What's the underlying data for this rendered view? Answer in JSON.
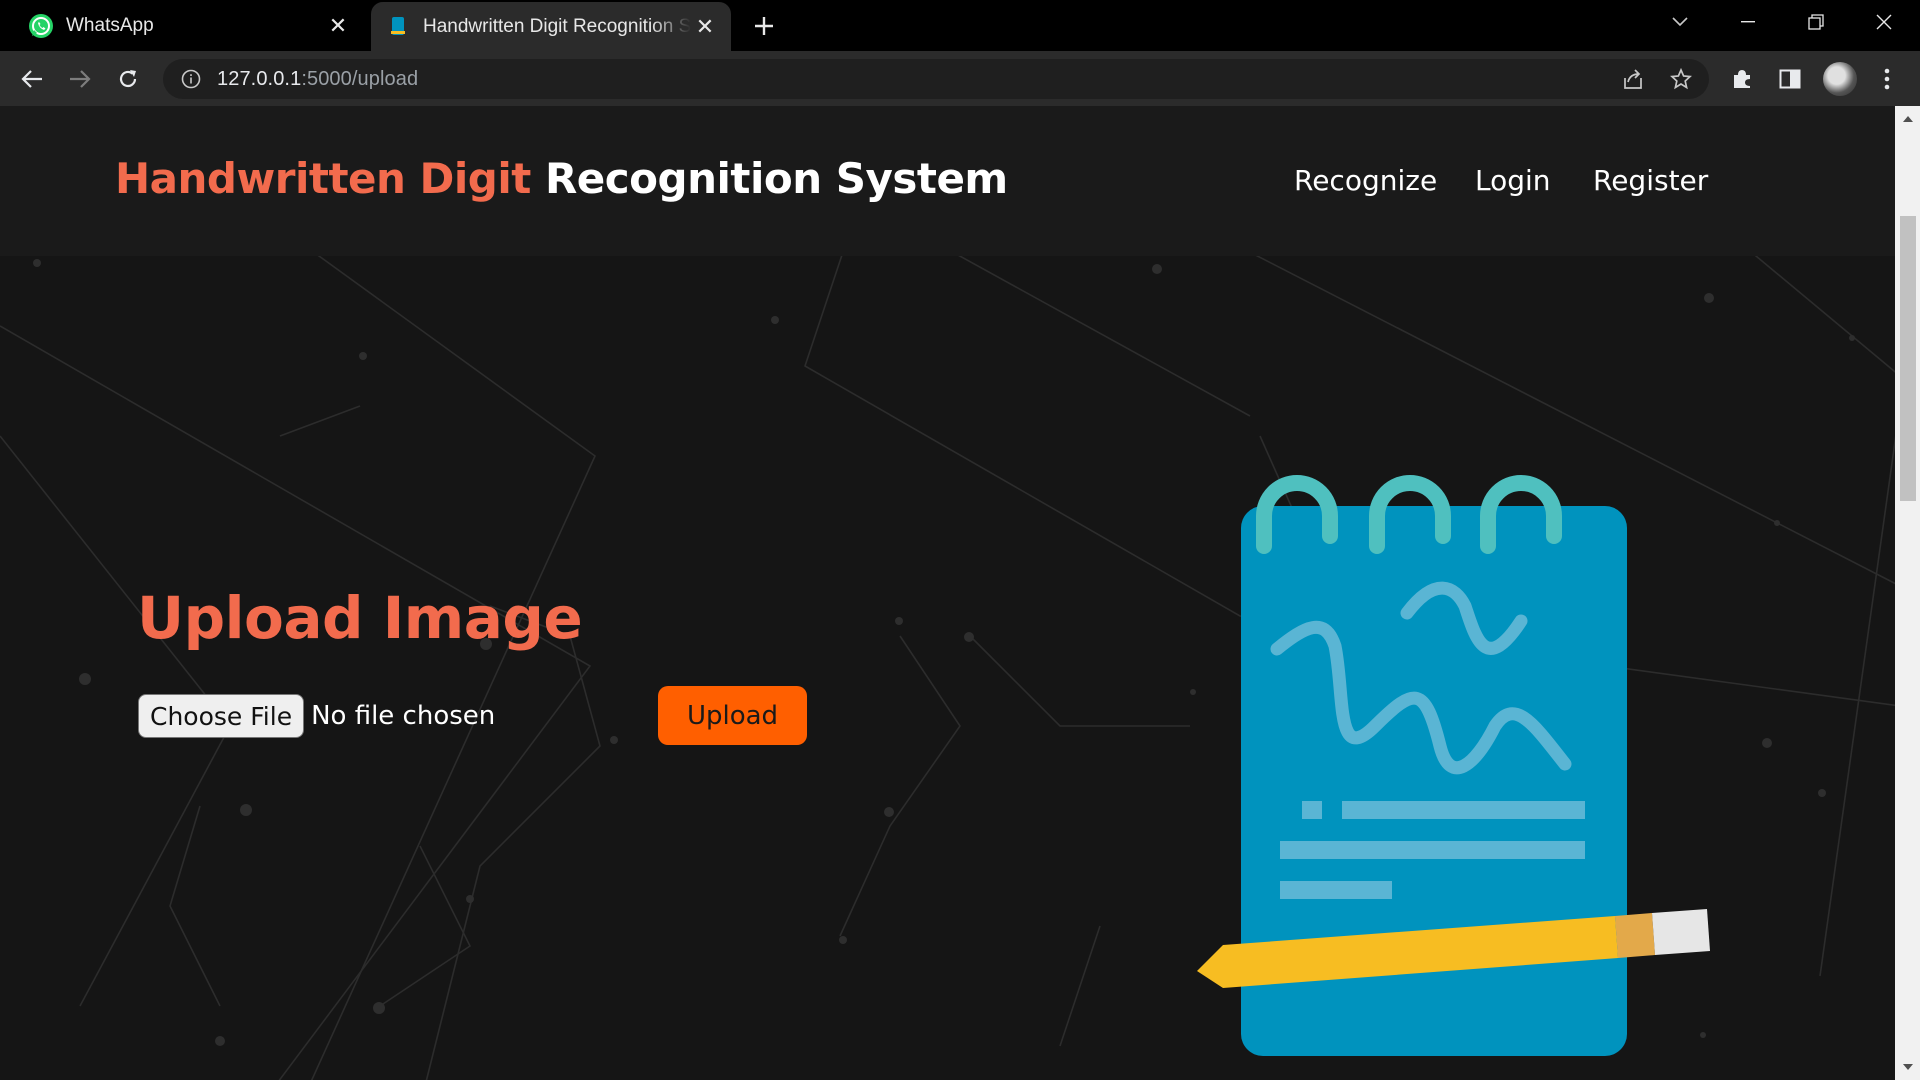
{
  "browser": {
    "tabs": [
      {
        "title": "WhatsApp",
        "active": false,
        "icon": "whatsapp-icon"
      },
      {
        "title": "Handwritten Digit Recognition System",
        "active": true,
        "icon": "page-favicon-icon"
      }
    ],
    "url_host": "127.0.0.1",
    "url_rest": ":5000/upload"
  },
  "site": {
    "brand_accent": "Handwritten Digit",
    "brand_rest": "Recognition System",
    "nav": [
      "Recognize",
      "Login",
      "Register"
    ]
  },
  "upload": {
    "title": "Upload Image",
    "choose_file": "Choose File",
    "no_file": "No file chosen",
    "button": "Upload"
  },
  "colors": {
    "accent": "#f26b4d",
    "button": "#ff5f00",
    "page_bg": "#151515",
    "notepad": "#0093be",
    "pencil": "#f7bd22"
  }
}
